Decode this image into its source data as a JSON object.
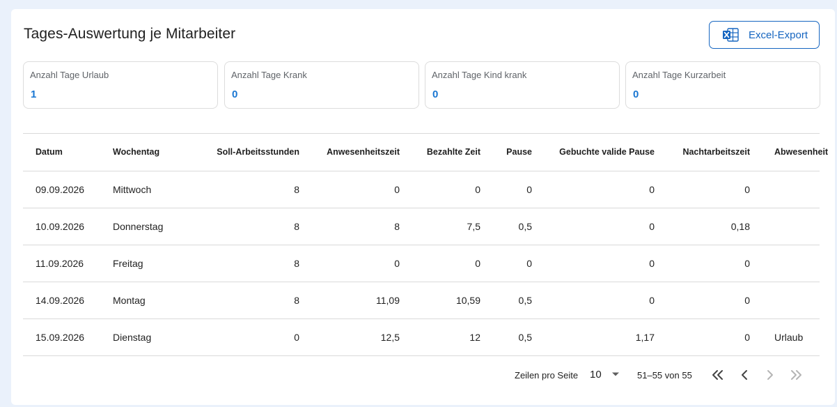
{
  "header": {
    "title": "Tages-Auswertung je Mitarbeiter",
    "export_label": "Excel-Export"
  },
  "stats": [
    {
      "label": "Anzahl Tage Urlaub",
      "value": "1"
    },
    {
      "label": "Anzahl Tage Krank",
      "value": "0"
    },
    {
      "label": "Anzahl Tage Kind krank",
      "value": "0"
    },
    {
      "label": "Anzahl Tage Kurzarbeit",
      "value": "0"
    }
  ],
  "table": {
    "columns": [
      "Datum",
      "Wochentag",
      "Soll-Arbeitsstunden",
      "Anwesenheitszeit",
      "Bezahlte Zeit",
      "Pause",
      "Gebuchte valide Pause",
      "Nachtarbeitszeit",
      "Abwesenheit"
    ],
    "rows": [
      [
        "09.09.2026",
        "Mittwoch",
        "8",
        "0",
        "0",
        "0",
        "0",
        "0",
        ""
      ],
      [
        "10.09.2026",
        "Donnerstag",
        "8",
        "8",
        "7,5",
        "0,5",
        "0",
        "0,18",
        ""
      ],
      [
        "11.09.2026",
        "Freitag",
        "8",
        "0",
        "0",
        "0",
        "0",
        "0",
        ""
      ],
      [
        "14.09.2026",
        "Montag",
        "8",
        "11,09",
        "10,59",
        "0,5",
        "0",
        "0",
        ""
      ],
      [
        "15.09.2026",
        "Dienstag",
        "0",
        "12,5",
        "12",
        "0,5",
        "1,17",
        "0",
        "Urlaub"
      ]
    ]
  },
  "pagination": {
    "rows_per_page_label": "Zeilen pro Seite",
    "rows_per_page": "10",
    "range": "51–55 von 55"
  },
  "colors": {
    "accent": "#1565c0",
    "value_blue": "#1976d2",
    "excel_green": "#1d6f42",
    "page_bg": "#eaf1fb"
  }
}
